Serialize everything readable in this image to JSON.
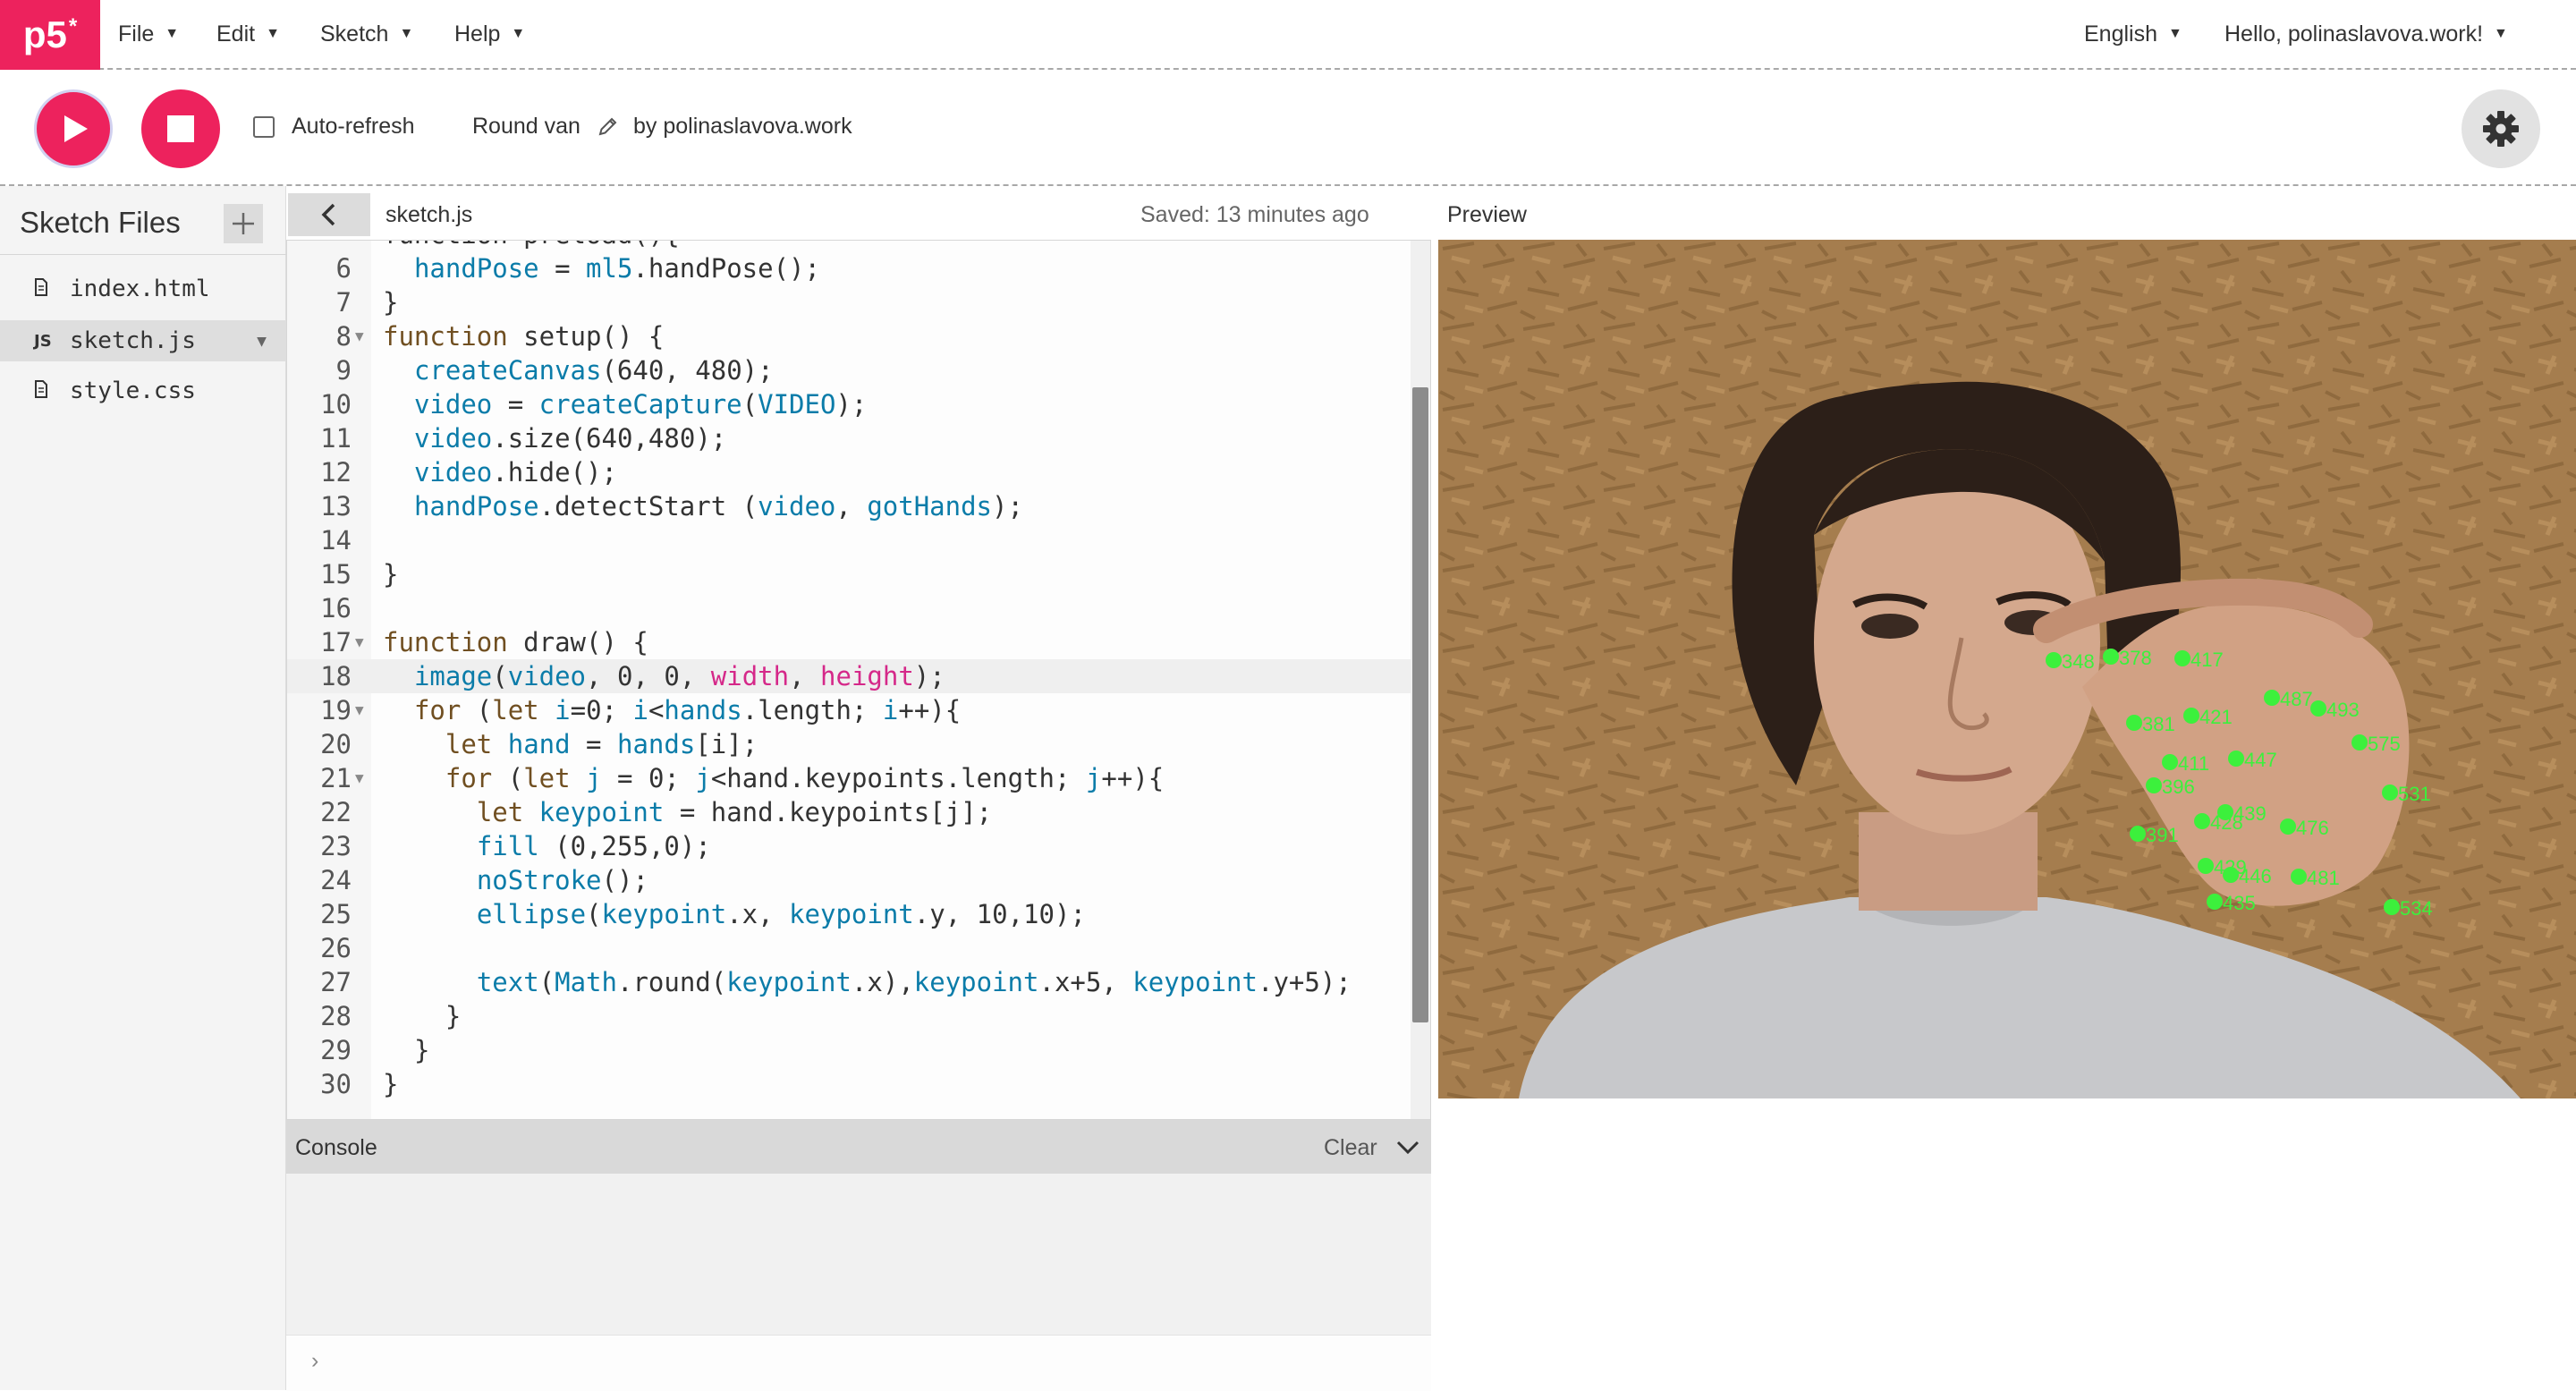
{
  "app": {
    "logo_text": "p5",
    "logo_star": "*"
  },
  "menu": {
    "file": "File",
    "edit": "Edit",
    "sketch": "Sketch",
    "help": "Help",
    "language": "English",
    "user_greeting": "Hello, polinaslavova.work!"
  },
  "toolbar": {
    "auto_refresh_label": "Auto-refresh",
    "sketch_name": "Round van",
    "by_author": "by polinaslavova.work"
  },
  "sidebar": {
    "title": "Sketch Files",
    "files": [
      {
        "name": "index.html",
        "icon": "file-icon"
      },
      {
        "name": "sketch.js",
        "icon": "js-icon",
        "badge": "JS"
      },
      {
        "name": "style.css",
        "icon": "file-icon"
      }
    ]
  },
  "editor": {
    "tab_name": "sketch.js",
    "saved_status": "Saved: 13 minutes ago",
    "partial_top_line": "function preload(){",
    "lines": [
      {
        "n": "6",
        "text": "  handPose = ml5.handPose();"
      },
      {
        "n": "7",
        "text": "}"
      },
      {
        "n": "8",
        "text": "function setup() {"
      },
      {
        "n": "9",
        "text": "  createCanvas(640, 480);"
      },
      {
        "n": "10",
        "text": "  video = createCapture(VIDEO);"
      },
      {
        "n": "11",
        "text": "  video.size(640,480);"
      },
      {
        "n": "12",
        "text": "  video.hide();"
      },
      {
        "n": "13",
        "text": "  handPose.detectStart (video, gotHands);"
      },
      {
        "n": "14",
        "text": ""
      },
      {
        "n": "15",
        "text": "}"
      },
      {
        "n": "16",
        "text": ""
      },
      {
        "n": "17",
        "text": "function draw() {"
      },
      {
        "n": "18",
        "text": "  image(video, 0, 0, width, height);"
      },
      {
        "n": "19",
        "text": "  for (let i=0; i<hands.length; i++){"
      },
      {
        "n": "20",
        "text": "    let hand = hands[i];"
      },
      {
        "n": "21",
        "text": "    for (let j = 0; j<hand.keypoints.length; j++){"
      },
      {
        "n": "22",
        "text": "      let keypoint = hand.keypoints[j];"
      },
      {
        "n": "23",
        "text": "      fill (0,255,0);"
      },
      {
        "n": "24",
        "text": "      noStroke();"
      },
      {
        "n": "25",
        "text": "      ellipse(keypoint.x, keypoint.y, 10,10);"
      },
      {
        "n": "26",
        "text": ""
      },
      {
        "n": "27",
        "text": "      text(Math.round(keypoint.x),keypoint.x+5, keypoint.y+5);"
      },
      {
        "n": "28",
        "text": "    }"
      },
      {
        "n": "29",
        "text": "  }"
      },
      {
        "n": "30",
        "text": "}"
      }
    ]
  },
  "console": {
    "title": "Console",
    "clear_label": "Clear",
    "prompt": "›"
  },
  "preview": {
    "label": "Preview",
    "keypoint_color": "#3cf03c",
    "keypoint_labels": [
      "348",
      "378",
      "417",
      "381",
      "421",
      "487",
      "493",
      "575",
      "411",
      "447",
      "396",
      "531",
      "439",
      "428",
      "476",
      "391",
      "429",
      "446",
      "481",
      "435",
      "534"
    ]
  },
  "colors": {
    "accent": "#ed225d",
    "keyword": "#704f21",
    "variable": "#0b7ca9",
    "builtin": "#d52889"
  }
}
